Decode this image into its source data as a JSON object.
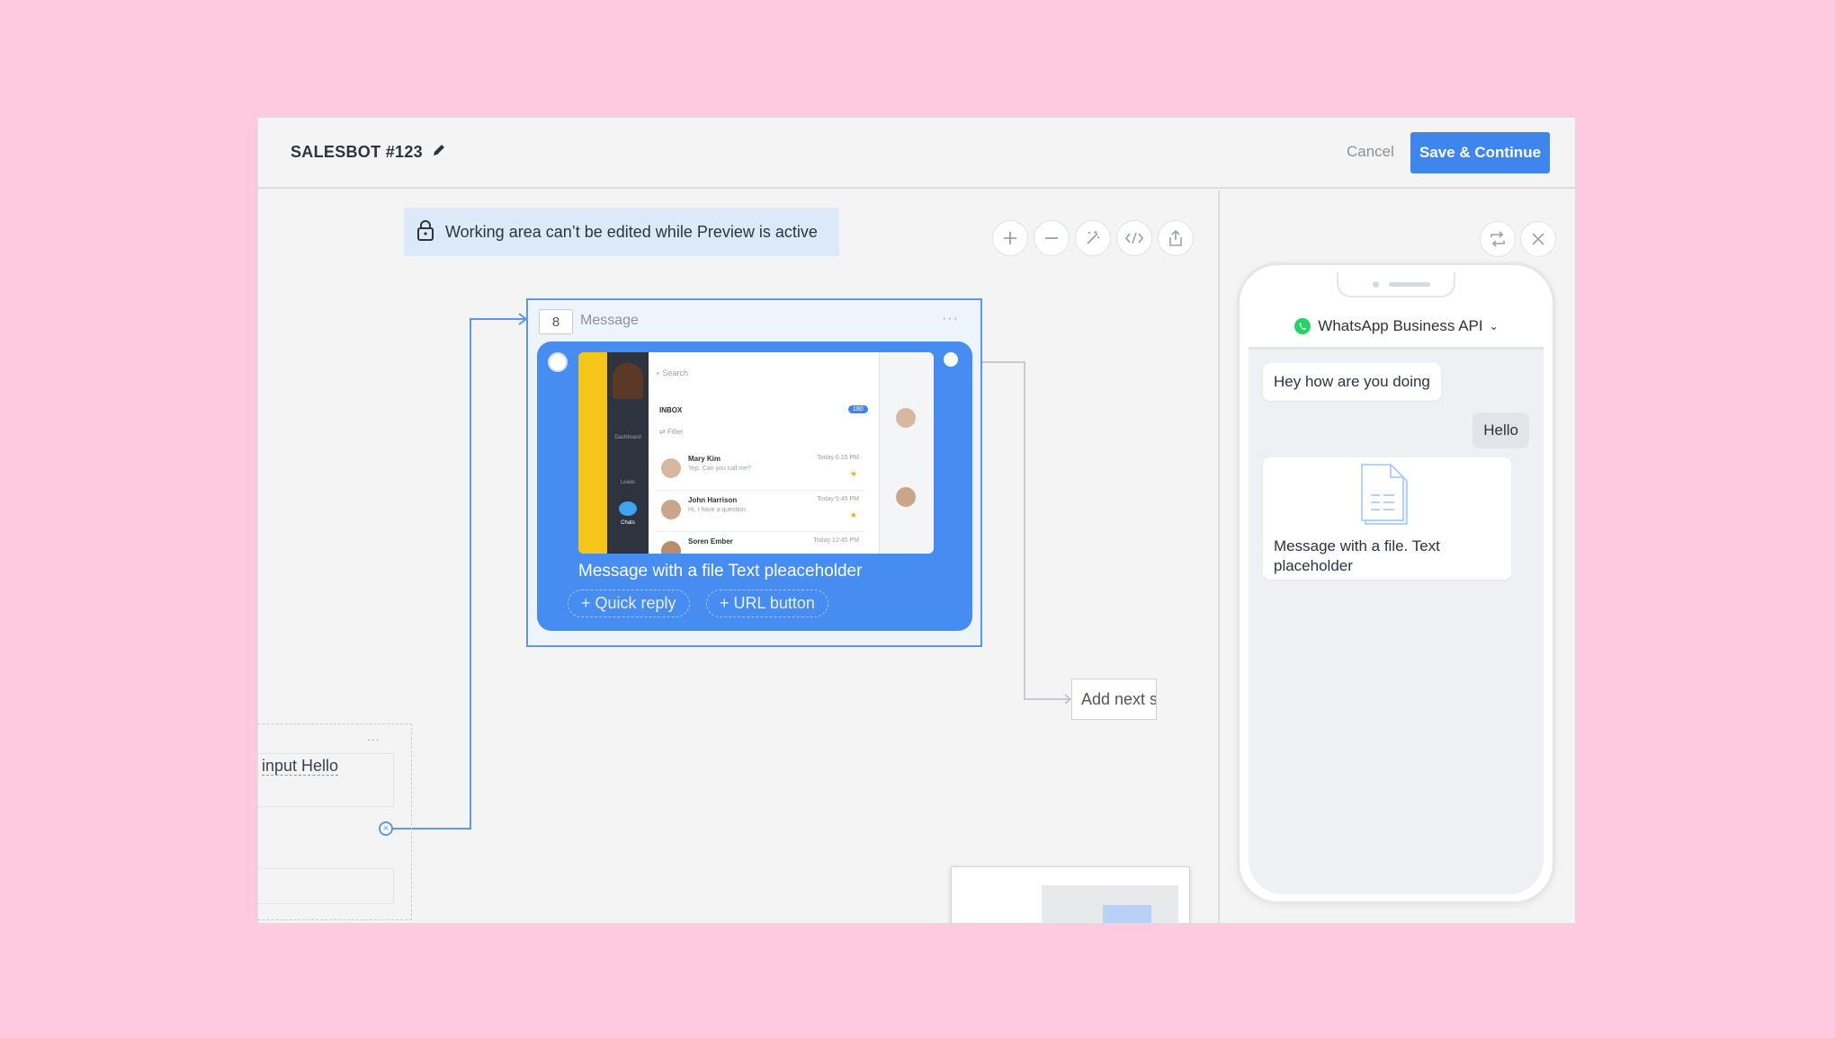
{
  "header": {
    "title": "SALESBOT #123",
    "cancel_label": "Cancel",
    "save_label": "Save & Continue"
  },
  "canvas": {
    "notice": "Working area can’t be edited while Preview is active",
    "toolbar_icons": [
      "plus-icon",
      "minus-icon",
      "magic-wand-icon",
      "code-icon",
      "export-icon"
    ],
    "message_node": {
      "number": "8",
      "label": "Message",
      "text": "Message with a file Text pleaceholder",
      "quick_reply": "+ Quick reply",
      "url_button": "+ URL button"
    },
    "embedded_screenshot": {
      "search_placeholder": "Search",
      "inbox_label": "INBOX",
      "inbox_count": "180",
      "filter_label": "Filter",
      "side_labels": [
        "Dashboard",
        "Leads",
        "Chats"
      ],
      "contacts": [
        {
          "name": "Mary Kim",
          "preview": "Yep. Can you call me?",
          "time": "Today 6:15 PM"
        },
        {
          "name": "John Harrison",
          "preview": "Hi, I have a question",
          "time": "Today 5:45 PM"
        },
        {
          "name": "Soren Ember",
          "preview": "",
          "time": "Today 12:45 PM"
        }
      ]
    },
    "add_next": "Add next s",
    "left_node_input": "input Hello",
    "left_node_dots": "···"
  },
  "preview": {
    "channel": "WhatsApp Business API",
    "messages": [
      {
        "from": "bot",
        "text": "Hey how are you doing"
      },
      {
        "from": "user",
        "text": "Hello"
      },
      {
        "from": "bot",
        "text": "Message with a file. Text placeholder",
        "attachment": "file-icon"
      }
    ]
  },
  "colors": {
    "background": "#ffc9e0",
    "accent": "#3f86ec",
    "node_bubble": "#478cf0",
    "whatsapp": "#25d366"
  }
}
